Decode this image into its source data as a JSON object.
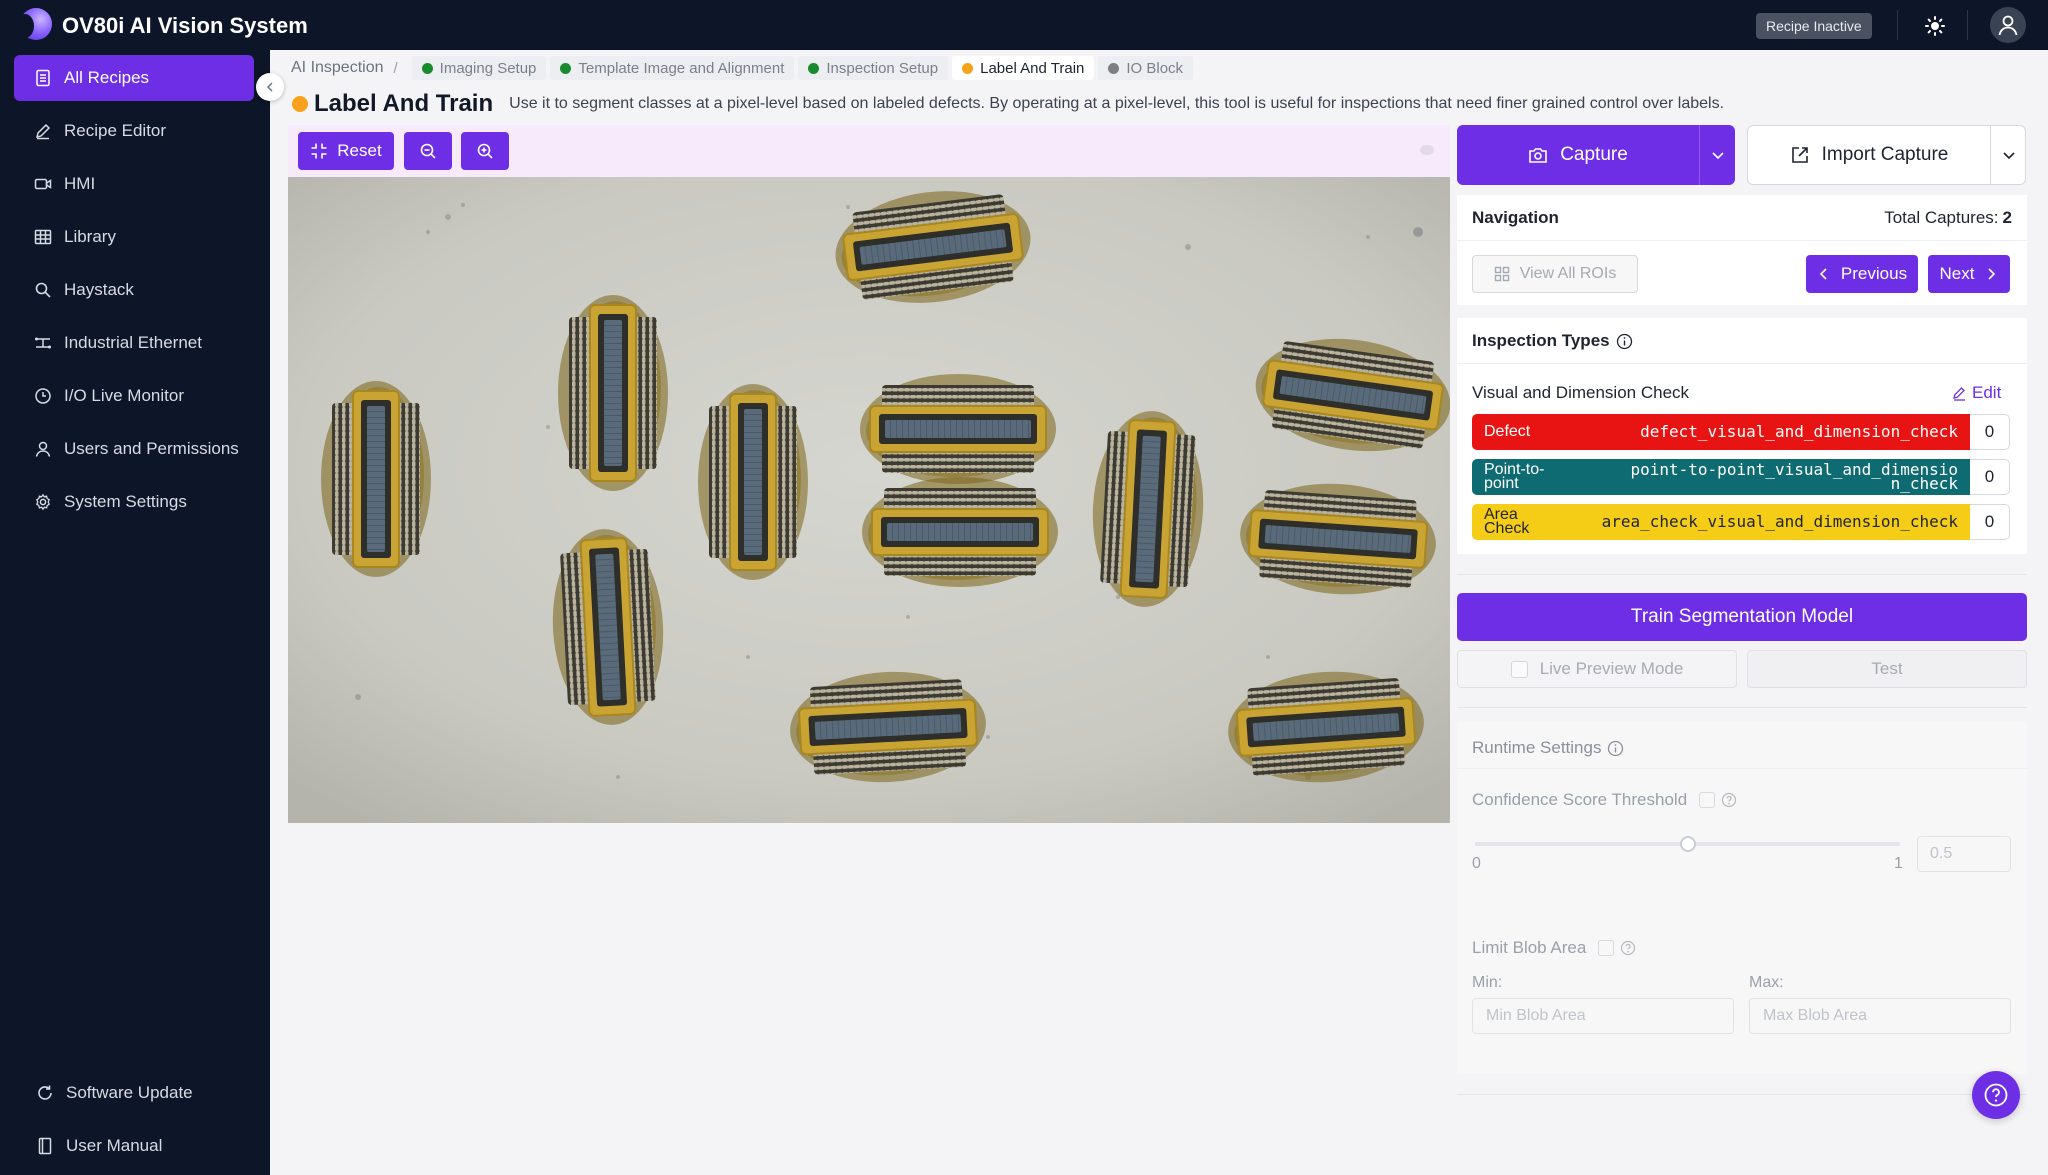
{
  "app": {
    "title": "OV80i AI Vision System",
    "status_badge": "Recipe Inactive"
  },
  "sidebar": {
    "items": [
      {
        "label": "All Recipes",
        "icon": "recipe-list-icon",
        "active": true
      },
      {
        "label": "Recipe Editor",
        "icon": "pencil-icon"
      },
      {
        "label": "HMI",
        "icon": "video-camera-icon"
      },
      {
        "label": "Library",
        "icon": "grid-table-icon"
      },
      {
        "label": "Haystack",
        "icon": "search-icon"
      },
      {
        "label": "Industrial Ethernet",
        "icon": "network-icon"
      },
      {
        "label": "I/O Live Monitor",
        "icon": "monitor-clock-icon"
      },
      {
        "label": "Users and Permissions",
        "icon": "user-icon"
      },
      {
        "label": "System Settings",
        "icon": "gear-icon"
      }
    ],
    "footer": [
      {
        "label": "Software Update",
        "icon": "refresh-icon"
      },
      {
        "label": "User Manual",
        "icon": "book-icon"
      }
    ]
  },
  "breadcrumb": {
    "root": "AI Inspection",
    "separator": "/",
    "steps": [
      {
        "label": "Imaging Setup",
        "status_color": "#1a8a2e"
      },
      {
        "label": "Template Image and Alignment",
        "status_color": "#1a8a2e"
      },
      {
        "label": "Inspection Setup",
        "status_color": "#1a8a2e"
      },
      {
        "label": "Label And Train",
        "status_color": "#f7a21b",
        "active": true
      },
      {
        "label": "IO Block",
        "status_color": "#7d7f85"
      }
    ]
  },
  "page": {
    "title": "Label And Train",
    "description": "Use it to segment classes at a pixel-level based on labeled defects. By operating at a pixel-level, this tool is useful for inspections that need finer grained control over labels."
  },
  "image_toolbar": {
    "reset_label": "Reset",
    "zoom_out_icon": "zoom-out-icon",
    "zoom_in_icon": "zoom-in-icon"
  },
  "capture": {
    "capture_label": "Capture",
    "import_label": "Import Capture"
  },
  "navigation": {
    "title": "Navigation",
    "total_label": "Total Captures:",
    "total_value": "2",
    "view_rois_label": "View All ROIs",
    "previous_label": "Previous",
    "next_label": "Next"
  },
  "inspection_types": {
    "title": "Inspection Types",
    "group_label": "Visual and Dimension Check",
    "edit_label": "Edit",
    "types": [
      {
        "name": "Defect",
        "id": "defect_visual_and_dimension_check",
        "count": "0",
        "color": "#e81414",
        "text_color": "#ffffff"
      },
      {
        "name": "Point-to-point",
        "id": "point-to-point_visual_and_dimension_check",
        "count": "0",
        "color": "#0e6b72",
        "text_color": "#ffffff"
      },
      {
        "name": "Area Check",
        "id": "area_check_visual_and_dimension_check",
        "count": "0",
        "color": "#f6cd16",
        "text_color": "#1f2330"
      }
    ]
  },
  "actions": {
    "train_label": "Train Segmentation Model",
    "live_preview_label": "Live Preview Mode",
    "test_label": "Test"
  },
  "runtime": {
    "title": "Runtime Settings",
    "confidence_label": "Confidence Score Threshold",
    "slider_min": "0",
    "slider_max": "1",
    "slider_value": 0.5,
    "confidence_value": "0.5",
    "limit_blob_label": "Limit Blob Area",
    "min_label": "Min:",
    "max_label": "Max:",
    "min_placeholder": "Min Blob Area",
    "max_placeholder": "Max Blob Area"
  }
}
